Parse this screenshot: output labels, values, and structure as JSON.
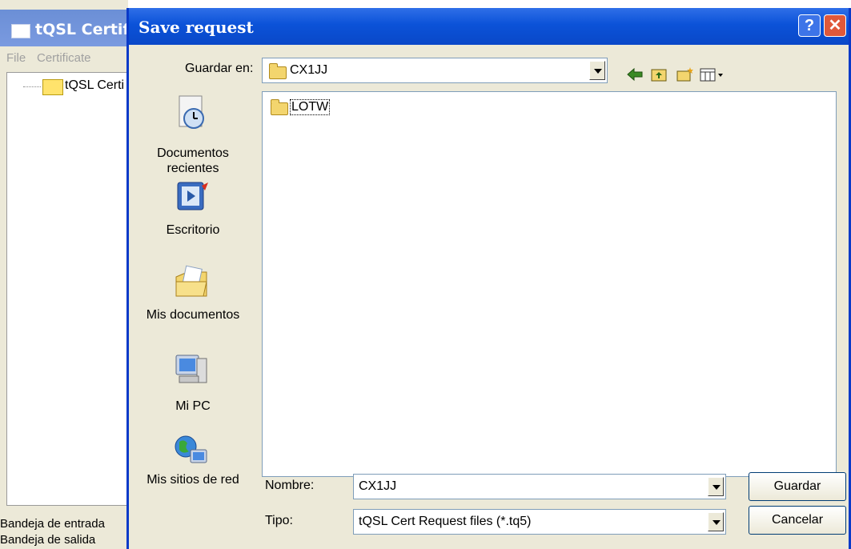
{
  "background_window": {
    "title": "tQSL Certif",
    "menu": [
      "File",
      "Certificate"
    ],
    "tree_item": "tQSL Certi",
    "status_lines": [
      "Bandeja de entrada",
      "Bandeja de salida"
    ]
  },
  "dialog": {
    "title": "Save request",
    "help_symbol": "?",
    "close_symbol": "✕",
    "look_in_label": "Guardar en:",
    "look_in_value": "CX1JJ",
    "toolbar_icons": [
      "back-arrow-icon",
      "up-folder-icon",
      "new-folder-icon",
      "view-menu-icon"
    ],
    "places": [
      {
        "icon": "recent-documents-icon",
        "label": "Documentos\nrecientes"
      },
      {
        "icon": "desktop-icon",
        "label": "Escritorio"
      },
      {
        "icon": "my-documents-icon",
        "label": "Mis documentos"
      },
      {
        "icon": "my-computer-icon",
        "label": "Mi PC"
      },
      {
        "icon": "network-places-icon",
        "label": "Mis sitios de red"
      }
    ],
    "files": [
      {
        "name": "LOTW",
        "type": "folder"
      }
    ],
    "filename_label": "Nombre:",
    "filename_value": "CX1JJ",
    "filetype_label": "Tipo:",
    "filetype_value": "tQSL Cert Request files (*.tq5)",
    "save_button": "Guardar",
    "cancel_button": "Cancelar"
  }
}
